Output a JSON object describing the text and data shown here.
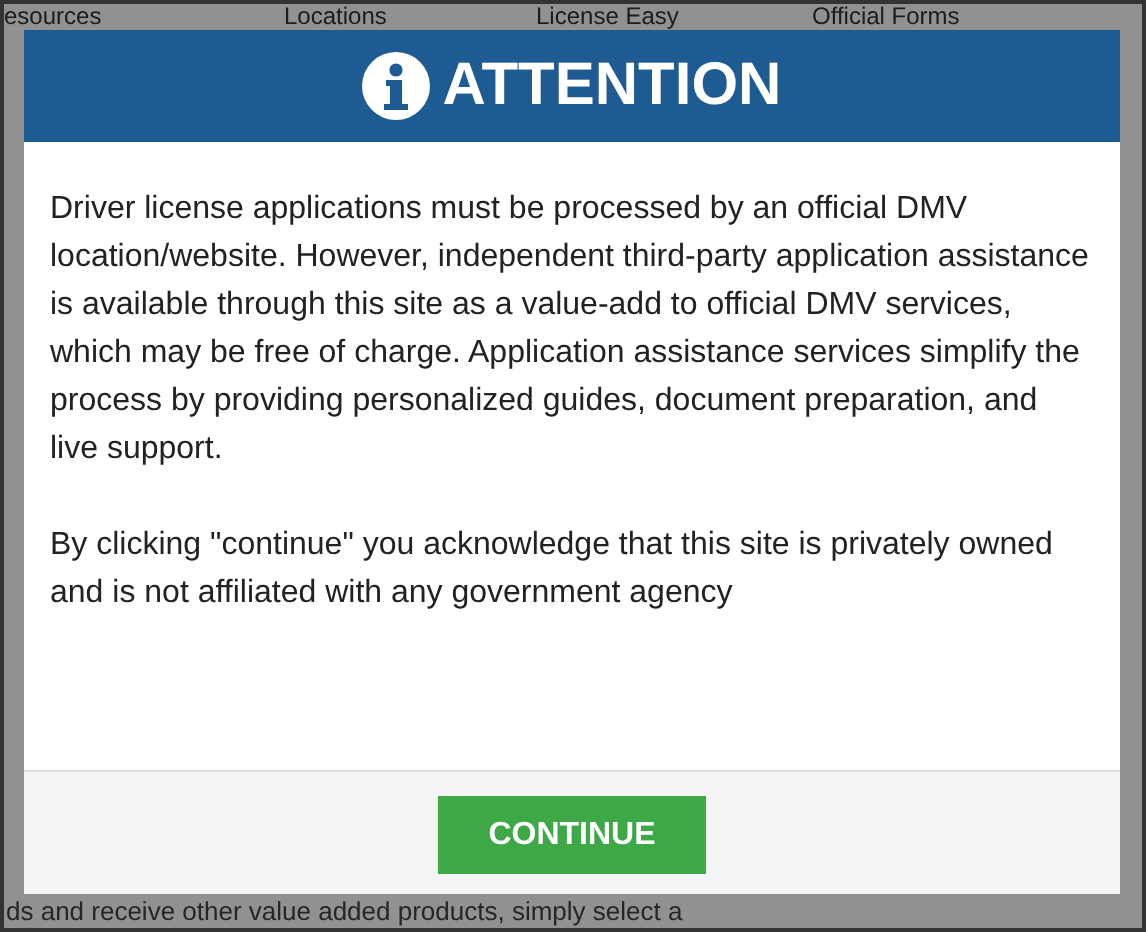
{
  "background_page": {
    "nav": [
      "esources",
      "Locations",
      "License Easy",
      "Official Forms"
    ],
    "footer_text": "ds and receive other value added products, simply select a"
  },
  "modal": {
    "title": "ATTENTION",
    "paragraphs": [
      "Driver license applications must be processed by an official DMV location/website. However, independent third-party application assistance is available through this site as a value-add to official DMV services, which may be free of charge. Application assistance services simplify the process by providing personalized guides, document preparation, and live support.",
      "By clicking \"continue\" you acknowledge that this site is privately owned and is not affiliated with any government agency"
    ],
    "button": "CONTINUE"
  }
}
